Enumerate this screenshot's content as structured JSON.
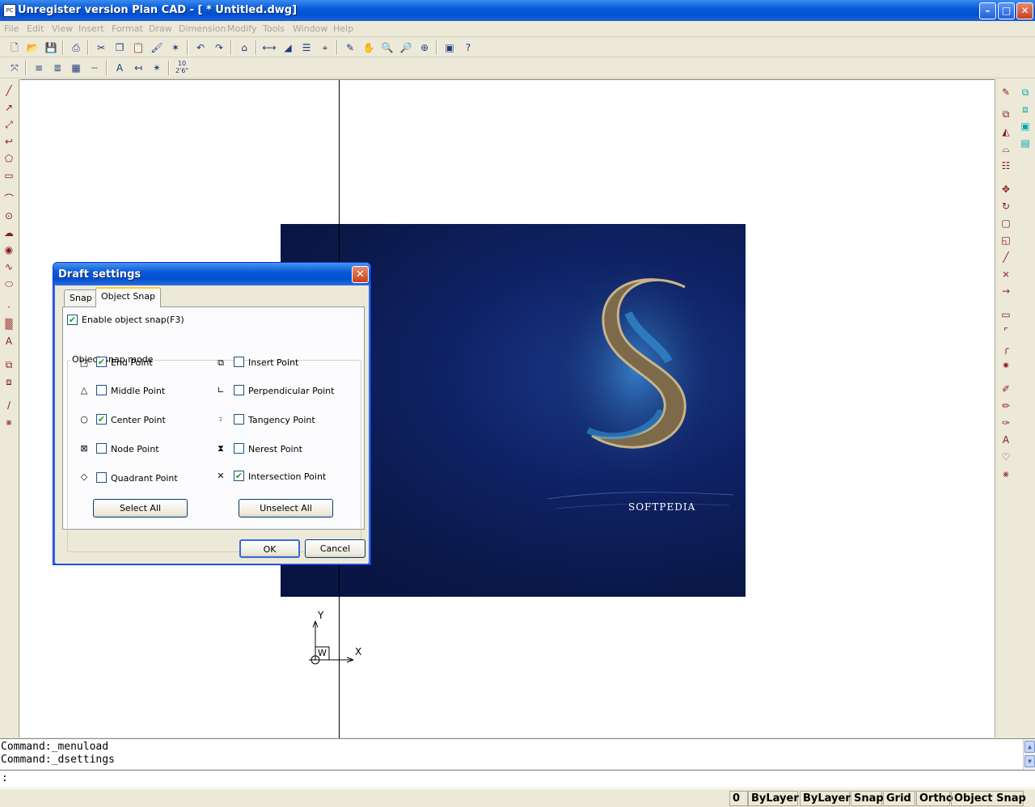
{
  "window": {
    "title": "Unregister version Plan CAD - [ * Untitled.dwg]",
    "app_icon_text": "PC",
    "minimize_glyph": "–",
    "maximize_glyph": "□",
    "close_glyph": "✕"
  },
  "menu": {
    "items": [
      "File",
      "Edit",
      "View",
      "Insert",
      "Format",
      "Draw",
      "Dimension",
      "Modify",
      "Tools",
      "Window",
      "Help"
    ]
  },
  "canvas": {
    "image_caption": "SOFTPEDIA",
    "ucs_y": "Y",
    "ucs_x": "X",
    "ucs_w": "W"
  },
  "dialog": {
    "title": "Draft settings",
    "close_glyph": "✕",
    "tabs": [
      "Snap",
      "Object Snap"
    ],
    "active_tab": "Object Snap",
    "enable_snap": {
      "label": "Enable object snap(F3)",
      "checked": true
    },
    "group_title": "Object snap mode",
    "snap_modes": [
      {
        "label": "End Point",
        "icon": "square-icon",
        "glyph": "□",
        "checked": true
      },
      {
        "label": "Middle Point",
        "icon": "triangle-icon",
        "glyph": "△",
        "checked": false
      },
      {
        "label": "Center Point",
        "icon": "circle-icon",
        "glyph": "○",
        "checked": true
      },
      {
        "label": "Node Point",
        "icon": "node-icon",
        "glyph": "⊠",
        "checked": false
      },
      {
        "label": "Quadrant Point",
        "icon": "diamond-icon",
        "glyph": "◇",
        "checked": false
      },
      {
        "label": "Insert Point",
        "icon": "insert-icon",
        "glyph": "⧉",
        "checked": false
      },
      {
        "label": "Perpendicular Point",
        "icon": "perpendicular-icon",
        "glyph": "∟",
        "checked": false
      },
      {
        "label": "Tangency Point",
        "icon": "tangent-icon",
        "glyph": "⍤",
        "checked": false
      },
      {
        "label": "Nerest Point",
        "icon": "hourglass-icon",
        "glyph": "⧗",
        "checked": false
      },
      {
        "label": "Intersection Point",
        "icon": "x-icon",
        "glyph": "✕",
        "checked": true
      }
    ],
    "check_glyph": "✔",
    "select_all": "Select All",
    "unselect_all": "Unselect All",
    "ok": "OK",
    "cancel": "Cancel"
  },
  "command": {
    "history": [
      "Command:_menuload",
      "Command:_dsettings"
    ],
    "prompt": ":",
    "scroll_up": "▲",
    "scroll_down": "▼"
  },
  "status": {
    "panels": [
      "0",
      "ByLayer",
      "ByLayer",
      "Snap",
      "Grid",
      "Ortho",
      "Object Snap"
    ]
  }
}
